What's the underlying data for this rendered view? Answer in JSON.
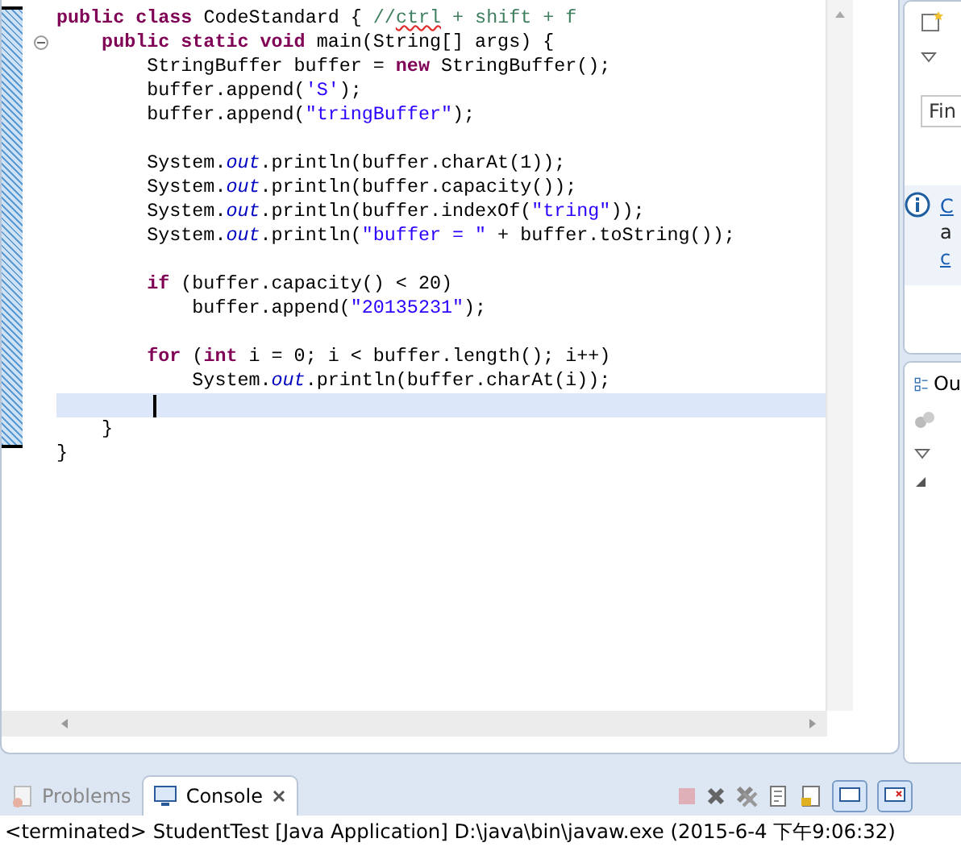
{
  "editor": {
    "lines": [
      {
        "segments": [
          {
            "text": "public ",
            "kind": "keyword"
          },
          {
            "text": "class ",
            "kind": "keyword"
          },
          {
            "text": "CodeStandard { ",
            "kind": "plain"
          },
          {
            "text": "//",
            "kind": "comment"
          },
          {
            "text": "ctrl",
            "kind": "flagged"
          },
          {
            "text": " + shift + f",
            "kind": "comment"
          }
        ],
        "current": false,
        "foldable": false
      },
      {
        "segments": [
          {
            "text": "    public ",
            "kind": "keyword"
          },
          {
            "text": "static ",
            "kind": "keyword"
          },
          {
            "text": "void ",
            "kind": "keyword"
          },
          {
            "text": "main(String[] args) {",
            "kind": "plain"
          }
        ],
        "current": false,
        "foldable": true
      },
      {
        "segments": [
          {
            "text": "        StringBuffer buffer = ",
            "kind": "plain"
          },
          {
            "text": "new",
            "kind": "keyword"
          },
          {
            "text": " StringBuffer();",
            "kind": "plain"
          }
        ],
        "current": false,
        "foldable": false
      },
      {
        "segments": [
          {
            "text": "        buffer.append(",
            "kind": "plain"
          },
          {
            "text": "'S'",
            "kind": "string"
          },
          {
            "text": ");",
            "kind": "plain"
          }
        ],
        "current": false,
        "foldable": false
      },
      {
        "segments": [
          {
            "text": "        buffer.append(",
            "kind": "plain"
          },
          {
            "text": "\"tringBuffer\"",
            "kind": "string"
          },
          {
            "text": ");",
            "kind": "plain"
          }
        ],
        "current": false,
        "foldable": false
      },
      {
        "current": false,
        "foldable": false
      },
      {
        "segments": [
          {
            "text": "        System.",
            "kind": "plain"
          },
          {
            "text": "out",
            "kind": "field"
          },
          {
            "text": ".println(buffer.charAt(1));",
            "kind": "plain"
          }
        ],
        "current": false,
        "foldable": false
      },
      {
        "segments": [
          {
            "text": "        System.",
            "kind": "plain"
          },
          {
            "text": "out",
            "kind": "field"
          },
          {
            "text": ".println(buffer.capacity());",
            "kind": "plain"
          }
        ],
        "current": false,
        "foldable": false
      },
      {
        "segments": [
          {
            "text": "        System.",
            "kind": "plain"
          },
          {
            "text": "out",
            "kind": "field"
          },
          {
            "text": ".println(buffer.indexOf(",
            "kind": "plain"
          },
          {
            "text": "\"tring\"",
            "kind": "string"
          },
          {
            "text": "));",
            "kind": "plain"
          }
        ],
        "current": false,
        "foldable": false
      },
      {
        "segments": [
          {
            "text": "        System.",
            "kind": "plain"
          },
          {
            "text": "out",
            "kind": "field"
          },
          {
            "text": ".println(",
            "kind": "plain"
          },
          {
            "text": "\"buffer = \"",
            "kind": "string"
          },
          {
            "text": " + buffer.toString());",
            "kind": "plain"
          }
        ],
        "current": false,
        "foldable": false
      },
      {
        "current": false,
        "foldable": false
      },
      {
        "segments": [
          {
            "text": "        if ",
            "kind": "keyword"
          },
          {
            "text": "(buffer.capacity() < 20)",
            "kind": "plain"
          }
        ],
        "current": false,
        "foldable": false
      },
      {
        "segments": [
          {
            "text": "            buffer.append(",
            "kind": "plain"
          },
          {
            "text": "\"20135231\"",
            "kind": "string"
          },
          {
            "text": ");",
            "kind": "plain"
          }
        ],
        "current": false,
        "foldable": false
      },
      {
        "current": false,
        "foldable": false
      },
      {
        "segments": [
          {
            "text": "        for ",
            "kind": "keyword"
          },
          {
            "text": "(",
            "kind": "plain"
          },
          {
            "text": "int",
            "kind": "keyword"
          },
          {
            "text": " i = 0; i < buffer.length(); i++)",
            "kind": "plain"
          }
        ],
        "current": false,
        "foldable": false
      },
      {
        "segments": [
          {
            "text": "            System.",
            "kind": "plain"
          },
          {
            "text": "out",
            "kind": "field"
          },
          {
            "text": ".println(buffer.charAt(i));",
            "kind": "plain"
          }
        ],
        "current": false,
        "foldable": false
      },
      {
        "current": true,
        "foldable": false
      },
      {
        "segments": [
          {
            "text": "    }",
            "kind": "plain"
          }
        ],
        "current": false,
        "foldable": false
      },
      {
        "segments": [
          {
            "text": "}",
            "kind": "plain"
          }
        ],
        "current": false,
        "foldable": false
      }
    ]
  },
  "side_panel": {
    "find": {
      "placeholder": "Fin"
    },
    "info": {
      "lines": [
        {
          "text": "C",
          "link": true
        },
        {
          "text": "a",
          "link": false
        },
        {
          "text": "c",
          "link": true
        }
      ]
    },
    "outline": {
      "title": "Ou"
    }
  },
  "bottom": {
    "tabs": [
      {
        "label": "Problems",
        "selected": false
      },
      {
        "label": "Console",
        "selected": true
      }
    ],
    "console_text": "<terminated> StudentTest [Java Application] D:\\java\\bin\\javaw.exe (2015-6-4 下午9:06:32)"
  }
}
